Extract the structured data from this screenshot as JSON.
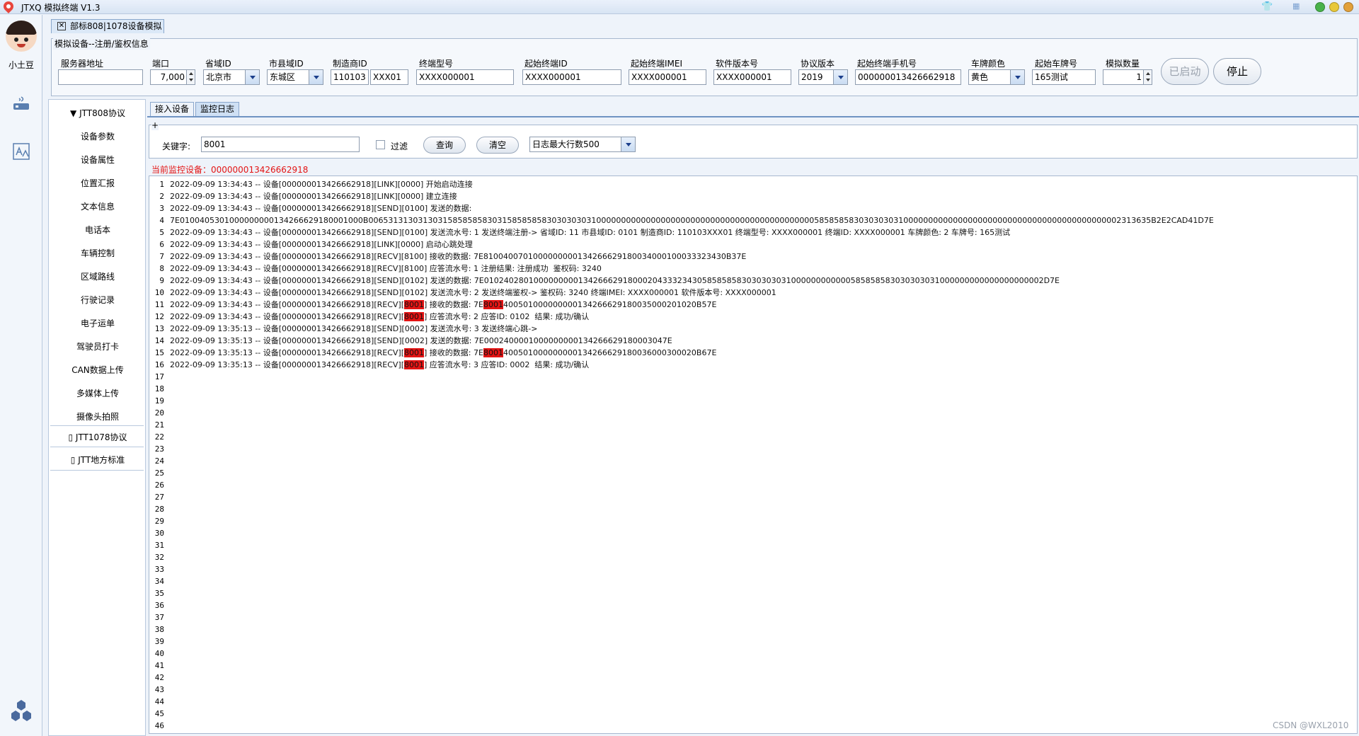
{
  "window": {
    "title": "JTXQ 模拟终端 V1.3"
  },
  "user": {
    "name": "小土豆"
  },
  "main_tab": {
    "label": "部标808|1078设备模拟"
  },
  "config": {
    "legend": "模拟设备--注册/鉴权信息",
    "server_label": "服务器地址",
    "server_value": "",
    "port_label": "端口",
    "port_value": "7,000",
    "province_label": "省域ID",
    "province_value": "北京市",
    "city_label": "市县域ID",
    "city_value": "东城区",
    "maker_label": "制造商ID",
    "maker_value_1": "110103",
    "maker_value_2": "XXX01",
    "model_label": "终端型号",
    "model_value": "XXXX000001",
    "start_terminal_label": "起始终端ID",
    "start_terminal_value": "XXXX000001",
    "imei_label": "起始终端IMEI",
    "imei_value": "XXXX000001",
    "software_label": "软件版本号",
    "software_value": "XXXX000001",
    "protocol_label": "协议版本",
    "protocol_value": "2019",
    "phone_label": "起始终端手机号",
    "phone_value": "000000013426662918",
    "color_label": "车牌颜色",
    "color_value": "黄色",
    "plate_label": "起始车牌号",
    "plate_value": "165测试",
    "count_label": "模拟数量",
    "count_value": "1",
    "started_label": "已启动",
    "stop_label": "停止"
  },
  "nav": {
    "items": [
      "▼ JTT808协议",
      "设备参数",
      "设备属性",
      "位置汇报",
      "文本信息",
      "电话本",
      "车辆控制",
      "区域路线",
      "行驶记录",
      "电子运单",
      "驾驶员打卡",
      "CAN数据上传",
      "多媒体上传",
      "摄像头拍照"
    ],
    "jtt1078": "▯ JTT1078协议",
    "local_std": "▯ JTT地方标准"
  },
  "subtabs": [
    "接入设备",
    "监控日志"
  ],
  "search": {
    "plus": "+",
    "keyword_label": "关键字:",
    "keyword_value": "8001",
    "filter_label": "过滤",
    "query_label": "查询",
    "clear_label": "清空",
    "maxlines_value": "日志最大行数500"
  },
  "monitor": {
    "label": "当前监控设备：000000013426662918"
  },
  "log": {
    "total_lines": 46,
    "lines": [
      [
        "2022-09-09 13:34:43 -- 设备[000000013426662918][LINK][0000] 开始启动连接"
      ],
      [
        "2022-09-09 13:34:43 -- 设备[000000013426662918][LINK][0000] 建立连接"
      ],
      [
        "2022-09-09 13:34:43 -- 设备[000000013426662918][SEND][0100] 发送的数据:"
      ],
      [
        "7E0100405301000000000134266629180001000B00653131303130315858585830315858585830303030310000000000000000000000000000000000000000000058585858303030303100000000000000000000000000000000000000000002313635B2E2CAD41D7E"
      ],
      [
        "2022-09-09 13:34:43 -- 设备[000000013426662918][SEND][0100] 发送流水号: 1 发送终端注册-> 省域ID: 11 市县域ID: 0101 制造商ID: 110103XXX01 终端型号: XXXX000001 终端ID: XXXX000001 车牌颜色: 2 车牌号: 165测试"
      ],
      [
        "2022-09-09 13:34:43 -- 设备[000000013426662918][LINK][0000] 启动心跳处理"
      ],
      [
        "2022-09-09 13:34:43 -- 设备[000000013426662918][RECV][8100] 接收的数据: 7E8100400701000000000134266629180034000100033323430B37E"
      ],
      [
        "2022-09-09 13:34:43 -- 设备[000000013426662918][RECV][8100] 应答流水号: 1 注册结果: 注册成功  鉴权码: 3240"
      ],
      [
        "2022-09-09 13:34:43 -- 设备[000000013426662918][SEND][0102] 发送的数据: 7E01024028010000000001342666291800020433323430585858583030303031000000000000585858583030303031000000000000000000002D7E"
      ],
      [
        "2022-09-09 13:34:43 -- 设备[000000013426662918][SEND][0102] 发送流水号: 2 发送终端鉴权-> 鉴权码: 3240 终端IMEI: XXXX000001 软件版本号: XXXX000001"
      ],
      [
        "2022-09-09 13:34:43 -- 设备[000000013426662918][RECV][",
        "8001",
        "] 接收的数据: 7E",
        "8001",
        "400501000000000134266629180035000201020B57E"
      ],
      [
        "2022-09-09 13:34:43 -- 设备[000000013426662918][RECV][",
        "8001",
        "] 应答流水号: 2 应答ID: 0102  结果: 成功/确认"
      ],
      [
        "2022-09-09 13:35:13 -- 设备[000000013426662918][SEND][0002] 发送流水号: 3 发送终端心跳->"
      ],
      [
        "2022-09-09 13:35:13 -- 设备[000000013426662918][SEND][0002] 发送的数据: 7E0002400001000000000134266629180003047E"
      ],
      [
        "2022-09-09 13:35:13 -- 设备[000000013426662918][RECV][",
        "8001",
        "] 接收的数据: 7E",
        "8001",
        "400501000000000134266629180036000300020B67E"
      ],
      [
        "2022-09-09 13:35:13 -- 设备[000000013426662918][RECV][",
        "8001",
        "] 应答流水号: 3 应答ID: 0002  结果: 成功/确认"
      ]
    ]
  },
  "watermark": "CSDN @WXL2010",
  "colors": {
    "highlight": "#e31414",
    "accent": "#6f93c2"
  }
}
